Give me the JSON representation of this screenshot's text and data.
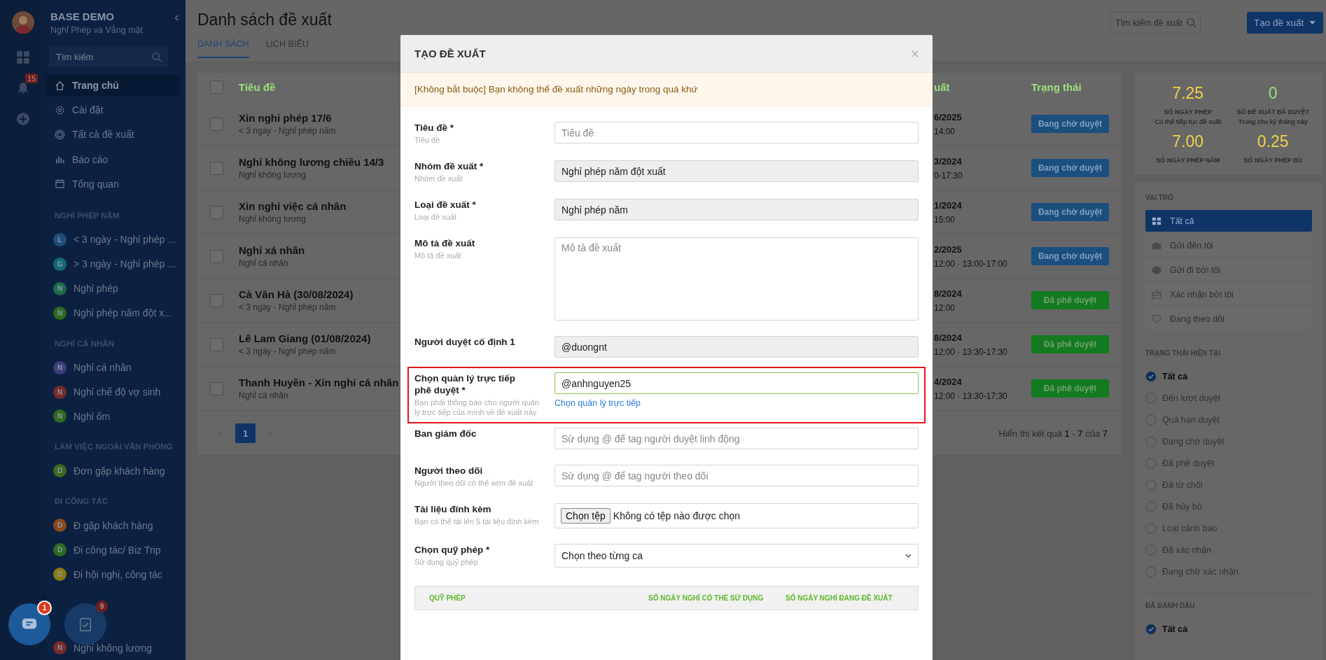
{
  "rail": {
    "notification_count": "15"
  },
  "sidebar": {
    "title": "BASE DEMO",
    "subtitle": "Nghỉ Phép và Vắng mặt",
    "search": {
      "placeholder": "Tìm kiếm"
    },
    "nav": [
      {
        "label": "Trang chủ",
        "selected": true
      },
      {
        "label": "Cài đặt",
        "selected": false
      },
      {
        "label": "Tất cả đề xuất",
        "selected": false
      },
      {
        "label": "Báo cáo",
        "selected": false
      },
      {
        "label": "Tổng quan",
        "selected": false
      }
    ],
    "groups": [
      {
        "heading": "NGHỈ PHÉP NĂM",
        "items": [
          {
            "letter": "L",
            "color": "#1f4f7a",
            "label": "< 3 ngày - Nghỉ phép ..."
          },
          {
            "letter": "G",
            "color": "#146a72",
            "label": "> 3 ngày - Nghỉ phép ..."
          },
          {
            "letter": "N",
            "color": "#1f6a4f",
            "label": "Nghỉ phép"
          },
          {
            "letter": "N",
            "color": "#2e6a1f",
            "label": "Nghỉ phép năm đột x..."
          }
        ]
      },
      {
        "heading": "NGHỈ CÁ NHÂN",
        "items": [
          {
            "letter": "N",
            "color": "#3b3f7a",
            "label": "Nghỉ cá nhân"
          },
          {
            "letter": "N",
            "color": "#7a2a2a",
            "label": "Nghỉ chế độ vợ sinh"
          },
          {
            "letter": "N",
            "color": "#2e6a1f",
            "label": "Nghỉ ốm"
          }
        ]
      },
      {
        "heading": "LÀM VIỆC NGOÀI VĂN PHÒNG",
        "items": [
          {
            "letter": "D",
            "color": "#3d6a1f",
            "label": "Đơn gặp khách hàng"
          }
        ]
      },
      {
        "heading": "ĐI CÔNG TÁC",
        "items": [
          {
            "letter": "D",
            "color": "#8a4a1a",
            "label": "Đ gặp khách hàng"
          },
          {
            "letter": "D",
            "color": "#2e6a1f",
            "label": "Đi công tác/ Biz Trip"
          },
          {
            "letter": "D",
            "color": "#8a7a10",
            "label": "Đi hội nghị, công tác"
          }
        ]
      },
      {
        "items": [
          {
            "letter": "N",
            "color": "#7a2a2a",
            "label": "Nghỉ không lương"
          }
        ]
      }
    ]
  },
  "fabs": [
    {
      "badge": "1"
    },
    {
      "badge": "9"
    }
  ],
  "page": {
    "title": "Danh sách đề xuất",
    "tabs": [
      {
        "label": "DANH SÁCH",
        "selected": true
      },
      {
        "label": "LỊCH BIỂU",
        "selected": false
      }
    ],
    "search": {
      "placeholder": "Tìm kiếm đề xuất"
    },
    "create_button": "Tạo đề xuất"
  },
  "table": {
    "header_checked": false,
    "columns": [
      "Tiêu đề",
      "uất",
      "Trạng thái"
    ],
    "rows": [
      {
        "checked": false,
        "title": "Xin nghỉ phép 17/6",
        "subtitle": "< 3 ngày - Nghỉ phép năm",
        "date": "6/2025",
        "time": "14:00",
        "kind": "pending",
        "status": "Đang chờ duyệt"
      },
      {
        "checked": false,
        "title": "Nghỉ không lương chiều 14/3",
        "subtitle": "Nghỉ không lương",
        "date": "3/2024",
        "time": "0-17:30",
        "kind": "pending",
        "status": "Đang chờ duyệt"
      },
      {
        "checked": false,
        "title": "Xin nghỉ việc cá nhân",
        "subtitle": "Nghỉ không lương",
        "date": "1/2024",
        "time": "15:00",
        "kind": "pending",
        "status": "Đang chờ duyệt"
      },
      {
        "checked": false,
        "title": "Nghỉ xá nhân",
        "subtitle": "Nghỉ cá nhân",
        "date": "2/2025",
        "time": "12:00 · 13:00-17:00",
        "kind": "pending",
        "status": "Đang chờ duyệt"
      },
      {
        "checked": false,
        "title": "Cà Văn Hà (30/08/2024)",
        "subtitle": "< 3 ngày - Nghỉ phép năm",
        "date": "8/2024",
        "time": "12:00",
        "kind": "approved",
        "status": "Đã phê duyệt"
      },
      {
        "checked": false,
        "title": "Lê Lam Giang (01/08/2024)",
        "subtitle": "< 3 ngày - Nghỉ phép năm",
        "date": "8/2024",
        "time": "12:00 · 13:30-17:30",
        "kind": "approved",
        "status": "Đã phê duyệt"
      },
      {
        "checked": false,
        "title": "Thanh Huyền - Xin nghỉ cá nhân",
        "subtitle": "Nghỉ cá nhân",
        "date": "4/2024",
        "time": "12:00 · 13:30-17:30",
        "kind": "approved",
        "status": "Đã phê duyệt"
      }
    ],
    "pages": [
      {
        "label": "1",
        "selected": true
      }
    ],
    "summary": "Hiển thị kết quả **1** - **7** của **7**"
  },
  "stats": [
    {
      "value": "7.25",
      "label": "SỐ NGÀY PHÉP",
      "note": "Có thể tiếp tục đề xuất",
      "color": "#f2d24a"
    },
    {
      "value": "0",
      "label": "SỐ ĐỀ XUẤT ĐÃ DUYỆT",
      "note": "Trong chu kỳ tháng này",
      "color": "#9be07a"
    },
    {
      "value": "7.00",
      "label": "SỐ NGÀY PHÉP NĂM",
      "color": "#f2d24a"
    },
    {
      "value": "0.25",
      "label": "SỐ NGÀY PHÉP BÙ",
      "color": "#f2d24a"
    }
  ],
  "roles": {
    "heading": "VAI TRÒ",
    "items": [
      {
        "label": "Tất cả",
        "selected": true
      },
      {
        "label": "Gửi đến tôi",
        "selected": false
      },
      {
        "label": "Gửi đi bởi tôi",
        "selected": false
      },
      {
        "label": "Xác nhận bởi tôi",
        "selected": false
      },
      {
        "label": "Đang theo dõi",
        "selected": false
      }
    ]
  },
  "status_filter": {
    "heading": "TRẠNG THÁI HIỆN TẠI",
    "items": [
      {
        "label": "Tất cả",
        "selected": true
      },
      {
        "label": "Đến lượt duyệt",
        "selected": false
      },
      {
        "label": "Quá hạn duyệt",
        "selected": false
      },
      {
        "label": "Đang chờ duyệt",
        "selected": false
      },
      {
        "label": "Đã phê duyệt",
        "selected": false
      },
      {
        "label": "Đã từ chối",
        "selected": false
      },
      {
        "label": "Đã hủy bỏ",
        "selected": false
      },
      {
        "label": "Loại cảnh báo",
        "selected": false
      },
      {
        "label": "Đã xác nhận",
        "selected": false
      },
      {
        "label": "Đang chờ xác nhận",
        "selected": false
      }
    ]
  },
  "marked": {
    "heading": "ĐÃ ĐÁNH DẤU",
    "items": [
      {
        "label": "Tất cả",
        "selected": true
      }
    ]
  },
  "modal": {
    "title": "TẠO ĐỀ XUẤT",
    "notice": "[Không bắt buộc] Bạn không thể đề xuất những ngày trong quá khứ",
    "fields": [
      {
        "kind": "text",
        "highlighted": false,
        "label": "Tiêu đề *",
        "hint": "Tiêu đề",
        "placeholder": "Tiêu đề"
      },
      {
        "kind": "readonly",
        "highlighted": false,
        "label": "Nhóm đề xuất *",
        "hint": "Nhóm đề xuất",
        "value": "Nghỉ phép năm đột xuất"
      },
      {
        "kind": "readonly",
        "highlighted": false,
        "label": "Loại đề xuất *",
        "hint": "Loại đề xuất",
        "value": "Nghỉ phép năm"
      },
      {
        "kind": "textarea",
        "highlighted": false,
        "label": "Mô tả đề xuất",
        "hint": "Mô tả đề xuất",
        "placeholder": "Mô tả đề xuất"
      },
      {
        "kind": "readonly",
        "highlighted": false,
        "label": "Người duyệt cố định 1",
        "value": "@duongnt"
      },
      {
        "kind": "text",
        "highlighted": true,
        "label": "Chọn quản lý trực tiếp phê duyệt *",
        "hint": "Bạn phải thông báo cho người quản lý trực tiếp của mình về đề xuất này",
        "value": "@anhnguyen25",
        "link": "Chọn quản lý trực tiếp"
      },
      {
        "kind": "text",
        "highlighted": false,
        "label": "Ban giám đốc",
        "placeholder": "Sử dụng @ để tag người duyệt linh động"
      },
      {
        "kind": "text",
        "highlighted": false,
        "label": "Người theo dõi",
        "hint": "Người theo dõi có thể xem đề xuất",
        "placeholder": "Sử dụng @ để tag người theo dõi"
      },
      {
        "kind": "file",
        "highlighted": false,
        "label": "Tài liệu đính kèm",
        "hint": "Bạn có thể tải lên 5 tài liệu đính kèm",
        "button": "Chọn tệp",
        "status": "Không có tệp nào được chọn"
      },
      {
        "kind": "select",
        "highlighted": false,
        "label": "Chọn quỹ phép *",
        "hint": "Sử dụng quỹ phép",
        "value": "Chọn theo từng ca"
      }
    ],
    "quota_table": {
      "columns": [
        "QUỸ PHÉP",
        "SỐ NGÀY NGHỈ CÓ THỂ SỬ DỤNG",
        "SỐ NGÀY NGHỈ ĐANG ĐỀ XUẤT"
      ]
    }
  }
}
